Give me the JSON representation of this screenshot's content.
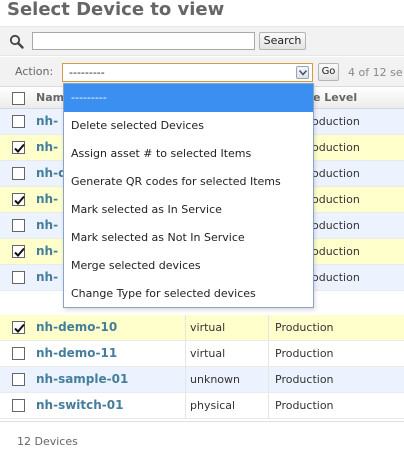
{
  "page": {
    "title": "Select Device to view"
  },
  "search": {
    "value": "",
    "placeholder": "",
    "button_label": "Search"
  },
  "actions": {
    "label": "Action:",
    "selected": "---------",
    "go_label": "Go",
    "count_text": "4 of 12 se",
    "options": [
      "---------",
      "Delete selected Devices",
      "Assign asset # to selected Items",
      "Generate QR codes for selected Items",
      "Mark selected as In Service",
      "Mark selected as Not In Service",
      "Merge selected devices",
      "Change Type for selected devices"
    ]
  },
  "table": {
    "columns": [
      "Nam",
      "e Level"
    ],
    "rows": [
      {
        "name": "nh-",
        "type": "",
        "service": "oduction",
        "checked": false
      },
      {
        "name": "nh-",
        "type": "",
        "service": "oduction",
        "checked": true
      },
      {
        "name": "nh-d",
        "type": "",
        "service": "oduction",
        "checked": false
      },
      {
        "name": "nh-",
        "type": "",
        "service": "oduction",
        "checked": true
      },
      {
        "name": "nh-",
        "type": "",
        "service": "oduction",
        "checked": false
      },
      {
        "name": "nh-",
        "type": "",
        "service": "oduction",
        "checked": true
      },
      {
        "name": "nh-",
        "type": "",
        "service": "oduction",
        "checked": false
      },
      {
        "name": "nh-demo-10",
        "type": "virtual",
        "service": "Production",
        "checked": true
      },
      {
        "name": "nh-demo-11",
        "type": "virtual",
        "service": "Production",
        "checked": false
      },
      {
        "name": "nh-sample-01",
        "type": "unknown",
        "service": "Production",
        "checked": false
      },
      {
        "name": "nh-switch-01",
        "type": "physical",
        "service": "Production",
        "checked": false
      }
    ]
  },
  "footer": {
    "text": "12 Devices"
  },
  "colors": {
    "link": "#447e9b",
    "row_alt": "#edf3fe",
    "row_selected": "#ffffcc",
    "dropdown_highlight": "#3a8ff0",
    "select_border": "#d89a3a"
  }
}
